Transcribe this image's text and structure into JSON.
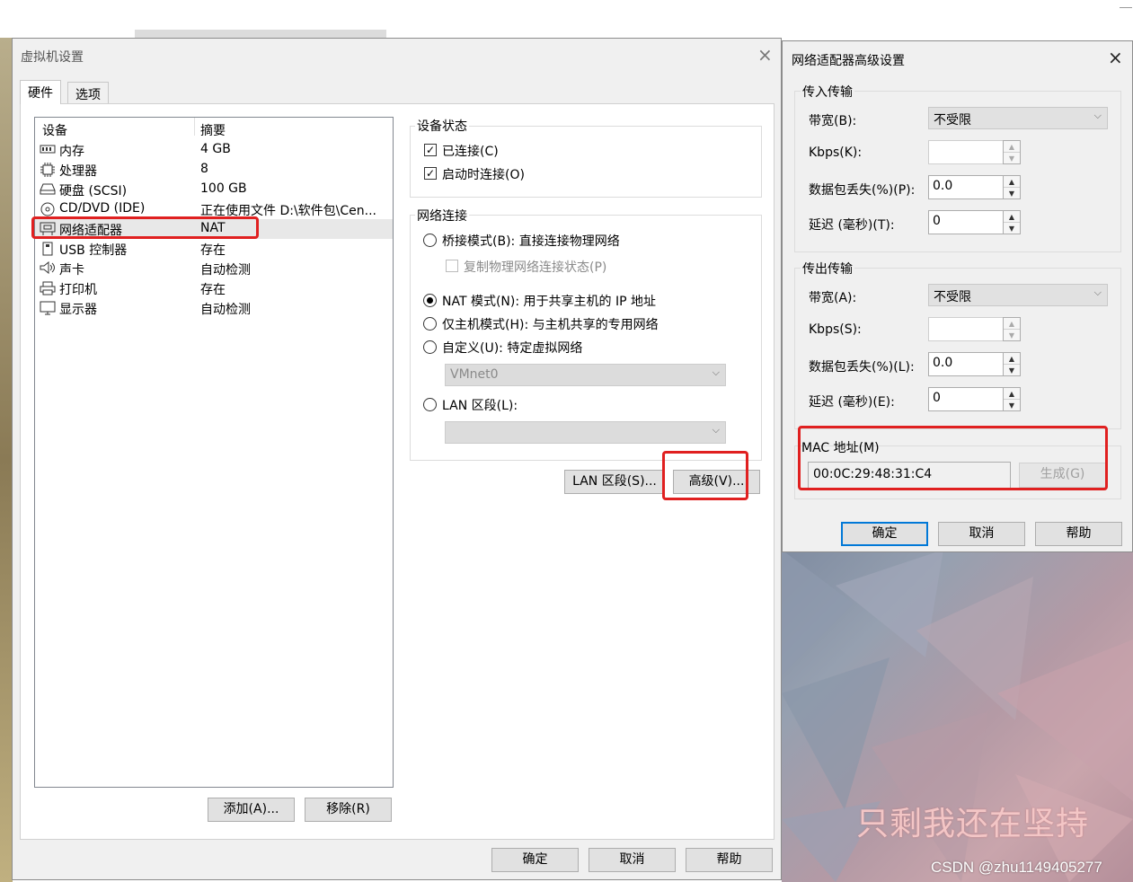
{
  "main_dialog": {
    "title": "虚拟机设置",
    "tabs": [
      {
        "label": "硬件",
        "active": true
      },
      {
        "label": "选项",
        "active": false
      }
    ],
    "device_table": {
      "headers": [
        "设备",
        "摘要"
      ],
      "rows": [
        {
          "icon": "memory-icon",
          "name": "内存",
          "summary": "4 GB"
        },
        {
          "icon": "processor-icon",
          "name": "处理器",
          "summary": "8"
        },
        {
          "icon": "hard-disk-icon",
          "name": "硬盘 (SCSI)",
          "summary": "100 GB"
        },
        {
          "icon": "cd-dvd-icon",
          "name": "CD/DVD (IDE)",
          "summary": "正在使用文件 D:\\软件包\\Cen..."
        },
        {
          "icon": "network-adapter-icon",
          "name": "网络适配器",
          "summary": "NAT",
          "selected": true
        },
        {
          "icon": "usb-icon",
          "name": "USB 控制器",
          "summary": "存在"
        },
        {
          "icon": "sound-card-icon",
          "name": "声卡",
          "summary": "自动检测"
        },
        {
          "icon": "printer-icon",
          "name": "打印机",
          "summary": "存在"
        },
        {
          "icon": "display-icon",
          "name": "显示器",
          "summary": "自动检测"
        }
      ]
    },
    "add_button": "添加(A)...",
    "remove_button": "移除(R)",
    "device_status": {
      "title": "设备状态",
      "connected": {
        "label": "已连接(C)",
        "checked": true
      },
      "connect_at_power_on": {
        "label": "启动时连接(O)",
        "checked": true
      }
    },
    "network_connection": {
      "title": "网络连接",
      "bridged": {
        "label": "桥接模式(B): 直接连接物理网络",
        "selected": false
      },
      "replicate_state": {
        "label": "复制物理网络连接状态(P)",
        "checked": false
      },
      "nat": {
        "label": "NAT 模式(N): 用于共享主机的 IP 地址",
        "selected": true
      },
      "host_only": {
        "label": "仅主机模式(H): 与主机共享的专用网络",
        "selected": false
      },
      "custom": {
        "label": "自定义(U): 特定虚拟网络",
        "selected": false
      },
      "custom_network_value": "VMnet0",
      "lan_segment": {
        "label": "LAN 区段(L):",
        "selected": false
      },
      "lan_segment_value": ""
    },
    "lan_segment_button": "LAN 区段(S)...",
    "advanced_button": "高级(V)...",
    "ok_button": "确定",
    "cancel_button": "取消",
    "help_button": "帮助"
  },
  "advanced_dialog": {
    "title": "网络适配器高级设置",
    "incoming": {
      "title": "传入传输",
      "bandwidth_label": "带宽(B):",
      "bandwidth_value": "不受限",
      "kbps_label": "Kbps(K):",
      "kbps_value": "",
      "packet_loss_label": "数据包丢失(%)(P):",
      "packet_loss_value": "0.0",
      "latency_label": "延迟 (毫秒)(T):",
      "latency_value": "0"
    },
    "outgoing": {
      "title": "传出传输",
      "bandwidth_label": "带宽(A):",
      "bandwidth_value": "不受限",
      "kbps_label": "Kbps(S):",
      "kbps_value": "",
      "packet_loss_label": "数据包丢失(%)(L):",
      "packet_loss_value": "0.0",
      "latency_label": "延迟 (毫秒)(E):",
      "latency_value": "0"
    },
    "mac": {
      "label": "MAC 地址(M)",
      "value": "00:0C:29:48:31:C4",
      "generate_button": "生成(G)"
    },
    "ok_button": "确定",
    "cancel_button": "取消",
    "help_button": "帮助"
  },
  "background": {
    "wallpaper_text": "只剩我还在坚持",
    "watermark": "CSDN @zhu1149405277"
  },
  "colors": {
    "highlight_box": "#e02020",
    "primary_button_border": "#0078d7",
    "dialog_bg": "#f0f0f0"
  }
}
